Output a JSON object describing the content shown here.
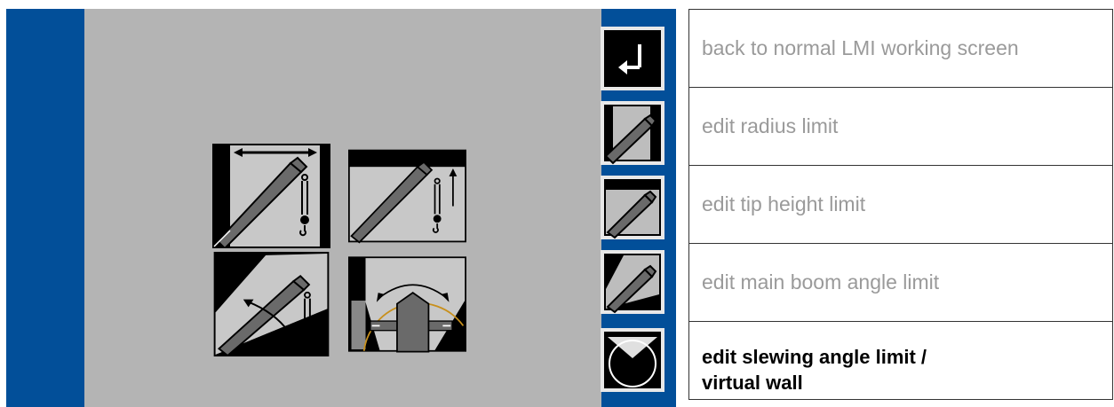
{
  "colors": {
    "panel_blue": "#024f99",
    "screen_gray": "#b4b4b4",
    "boom_gray": "#6a6a6a",
    "inactive_text": "#9a9a9a",
    "active_text": "#000000",
    "slew_line": "#c8901c"
  },
  "main_icons": [
    {
      "name": "radius-limit-icon",
      "meaning": "radius limit"
    },
    {
      "name": "tip-height-limit-icon",
      "meaning": "tip height limit"
    },
    {
      "name": "boom-angle-limit-icon",
      "meaning": "main boom angle limit"
    },
    {
      "name": "slewing-angle-limit-icon",
      "meaning": "slewing angle limit / virtual wall"
    }
  ],
  "side_buttons": [
    {
      "icon": "enter-return-icon"
    },
    {
      "icon": "radius-limit-icon"
    },
    {
      "icon": "tip-height-limit-icon"
    },
    {
      "icon": "boom-angle-limit-icon"
    },
    {
      "icon": "slewing-angle-limit-icon"
    }
  ],
  "legend": [
    {
      "label": "back to normal LMI working screen"
    },
    {
      "label": "edit radius limit"
    },
    {
      "label": "edit tip height limit"
    },
    {
      "label": "edit main boom angle limit"
    },
    {
      "label": "edit slewing angle limit /\nvirtual wall"
    }
  ]
}
